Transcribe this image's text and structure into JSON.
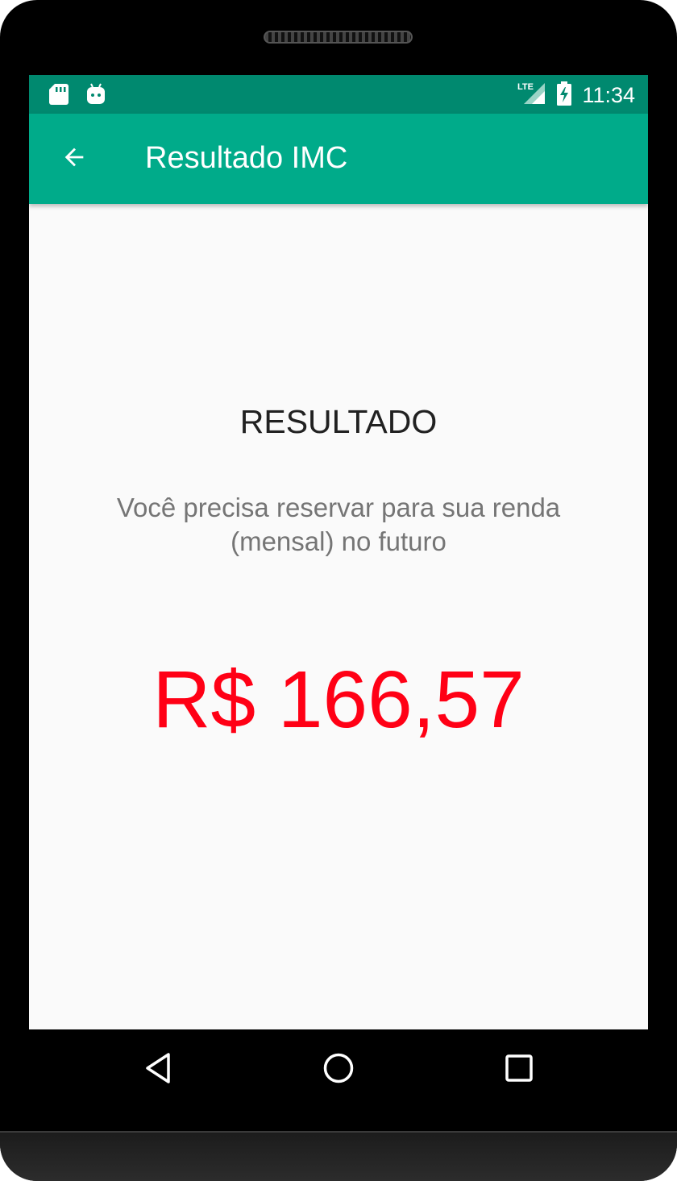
{
  "status_bar": {
    "time": "11:34",
    "network": "LTE",
    "icons_left": [
      "sd-card-icon",
      "android-debug-icon"
    ],
    "icons_right": [
      "lte-signal-icon",
      "battery-charging-icon"
    ]
  },
  "app_bar": {
    "title": "Resultado IMC",
    "back_icon": "arrow-back-icon",
    "color": "#00ab8a"
  },
  "main": {
    "heading": "RESULTADO",
    "message": "Você precisa reservar para sua renda (mensal) no futuro",
    "amount": "R$ 166,57",
    "amount_color": "#ff0015"
  },
  "nav_bar": {
    "buttons": [
      "back-triangle-icon",
      "home-circle-icon",
      "recents-square-icon"
    ]
  }
}
